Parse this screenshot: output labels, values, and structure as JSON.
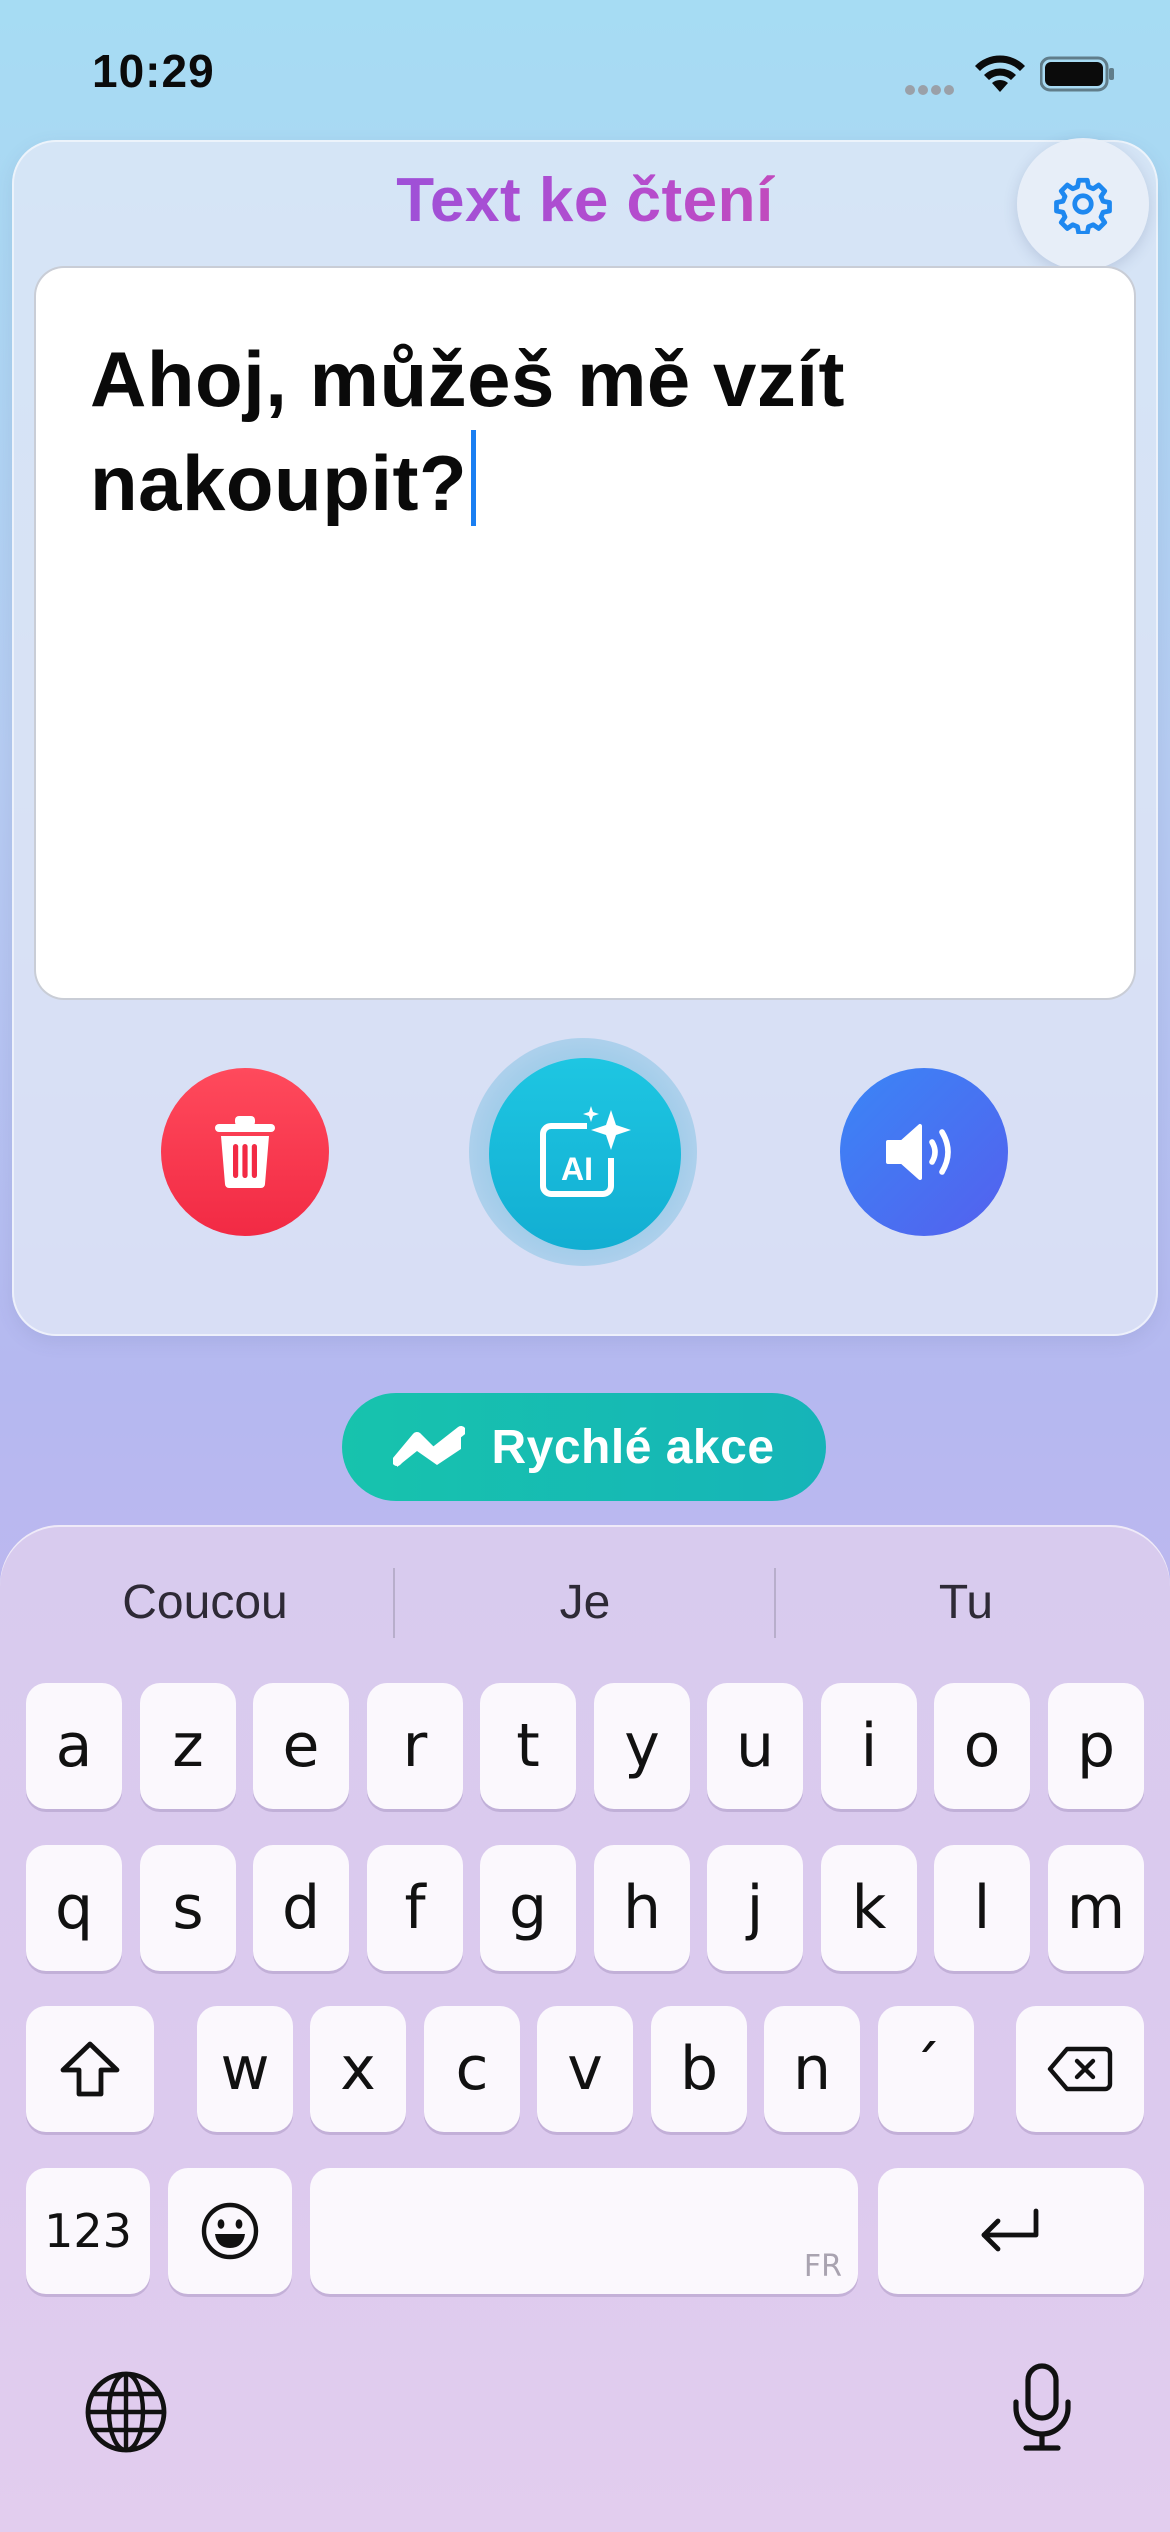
{
  "status_bar": {
    "time": "10:29",
    "icons": [
      "cellular-signal-icon",
      "wifi-icon",
      "battery-icon"
    ]
  },
  "card": {
    "title": "Text ke čtení",
    "settings_icon": "gear-icon",
    "text_line_1": "Ahoj, můžeš mě vzít",
    "text_line_2": "nakoupit?",
    "buttons": {
      "delete_icon": "trash-icon",
      "ai_icon": "ai-sparkle-icon",
      "speak_icon": "speaker-icon"
    }
  },
  "quick_actions": {
    "label": "Rychlé akce",
    "icon": "zigzag-icon"
  },
  "keyboard": {
    "suggestions": [
      "Coucou",
      "Je",
      "Tu"
    ],
    "row1": [
      "a",
      "z",
      "e",
      "r",
      "t",
      "y",
      "u",
      "i",
      "o",
      "p"
    ],
    "row2": [
      "q",
      "s",
      "d",
      "f",
      "g",
      "h",
      "j",
      "k",
      "l",
      "m"
    ],
    "row3": [
      "w",
      "x",
      "c",
      "v",
      "b",
      "n",
      "´"
    ],
    "numbers_label": "123",
    "space_language": "FR",
    "icons": [
      "shift-icon",
      "backspace-icon",
      "emoji-icon",
      "return-icon",
      "globe-icon",
      "microphone-icon"
    ]
  },
  "colors": {
    "title_gradient": [
      "#7b57e8",
      "#e5468d"
    ],
    "delete": "#f22a44",
    "ai": "#12aed2",
    "speak": "#3a86f6",
    "quick_actions": "#17c3ad",
    "caret": "#1a7ff2"
  }
}
